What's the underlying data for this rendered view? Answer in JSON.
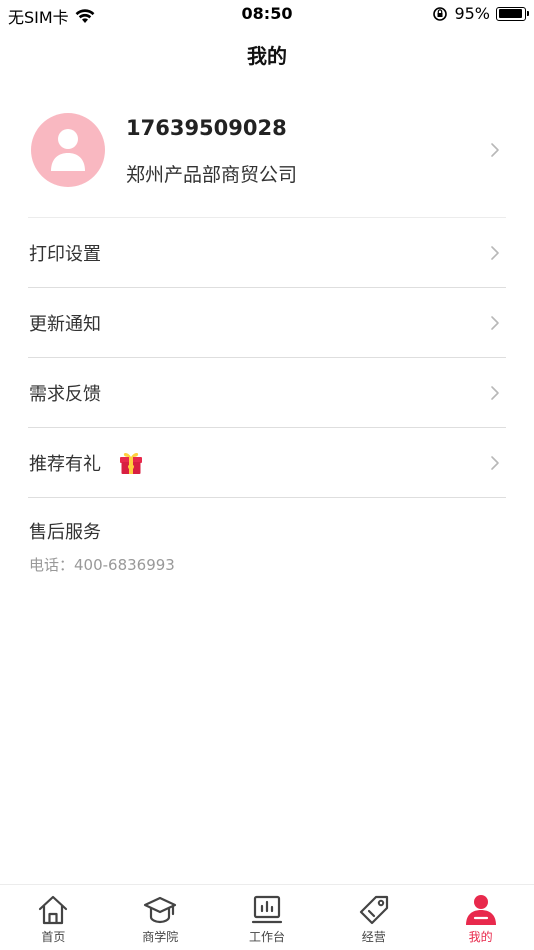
{
  "status_bar": {
    "carrier": "无SIM卡",
    "time": "08:50",
    "battery_percent": "95%",
    "battery_level": 0.95
  },
  "header": {
    "title": "我的"
  },
  "profile": {
    "phone": "17639509028",
    "company": "郑州产品部商贸公司"
  },
  "menu": [
    {
      "label": "打印设置"
    },
    {
      "label": "更新通知"
    },
    {
      "label": "需求反馈"
    },
    {
      "label": "推荐有礼",
      "icon": "gift-icon"
    }
  ],
  "after_sales": {
    "title": "售后服务",
    "phone": "电话：400-6836993"
  },
  "tabs": [
    {
      "label": "首页",
      "icon": "home-icon",
      "active": false
    },
    {
      "label": "商学院",
      "icon": "graduation-cap-icon",
      "active": false
    },
    {
      "label": "工作台",
      "icon": "workbench-icon",
      "active": false
    },
    {
      "label": "经营",
      "icon": "tag-icon",
      "active": false
    },
    {
      "label": "我的",
      "icon": "user-icon",
      "active": true
    }
  ],
  "colors": {
    "accent": "#e8294c",
    "avatar_bg": "#f9b8c1",
    "gift": "#e8294c"
  }
}
